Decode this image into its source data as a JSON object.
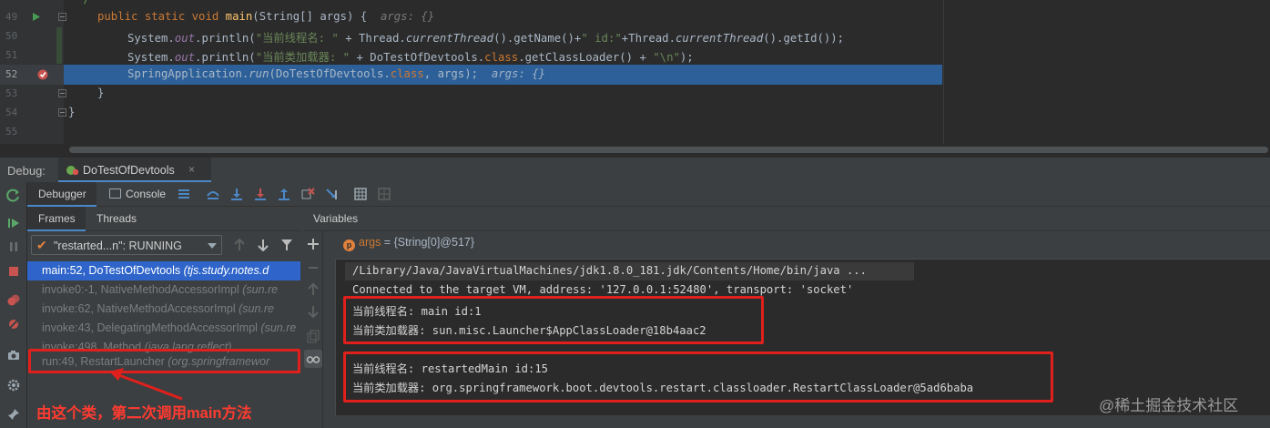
{
  "editor": {
    "line_numbers": [
      "49",
      "50",
      "51",
      "52",
      "53",
      "54",
      "55"
    ],
    "lines": {
      "l48_fragment": "*/",
      "l49": {
        "kw1": "public static void ",
        "method": "main",
        "rest": "(String[] args) {",
        "hint": "args: {}"
      },
      "l50": {
        "a": "System.",
        "out": "out",
        "b": ".println(",
        "s1": "\"当前线程名: \"",
        "c": " + Thread.",
        "ct": "currentThread",
        "d": "().getName()+",
        "s2": "\" id:\"",
        "e": "+Thread.",
        "ct2": "currentThread",
        "f": "().getId());"
      },
      "l51": {
        "a": "System.",
        "out": "out",
        "b": ".println(",
        "s1": "\"当前类加载器: \"",
        "c": " + DoTestOfDevtools.",
        "kw": "class",
        "d": ".getClassLoader() + ",
        "s2": "\"\\n\"",
        "e": ");"
      },
      "l52": {
        "a": "SpringApplication.",
        "run": "run",
        "b": "(DoTestOfDevtools.",
        "kw": "class",
        "c": ", args);",
        "hint": "args: {}"
      },
      "l53": "}",
      "l54": "}"
    }
  },
  "debug": {
    "title": "Debug:",
    "tab_label": "DoTestOfDevtools",
    "tab_close": "×",
    "toolbar": {
      "debugger_label": "Debugger",
      "console_label": "Console"
    },
    "frames_tab": "Frames",
    "threads_tab": "Threads",
    "thread_selector": "\"restarted...n\": RUNNING",
    "frames": [
      {
        "text": "main:52, DoTestOfDevtools ",
        "pkg": "(tjs.study.notes.d"
      },
      {
        "text": "invoke0:-1, NativeMethodAccessorImpl ",
        "pkg": "(sun.re"
      },
      {
        "text": "invoke:62, NativeMethodAccessorImpl ",
        "pkg": "(sun.re"
      },
      {
        "text": "invoke:43, DelegatingMethodAccessorImpl ",
        "pkg": "(sun.re"
      },
      {
        "text": "invoke:498, Method ",
        "pkg": "(java.lang.reflect)"
      },
      {
        "text": "run:49, RestartLauncher ",
        "pkg": "(org.springframewor"
      }
    ],
    "variables_label": "Variables",
    "variable": {
      "badge": "p",
      "name": "args",
      "value": " = {String[0]@517}"
    }
  },
  "console": {
    "lines": [
      "/Library/Java/JavaVirtualMachines/jdk1.8.0_181.jdk/Contents/Home/bin/java ...",
      "Connected to the target VM, address: '127.0.0.1:52480', transport: 'socket'",
      "当前线程名: main id:1",
      "当前类加载器: sun.misc.Launcher$AppClassLoader@18b4aac2",
      "",
      "当前线程名: restartedMain id:15",
      "当前类加载器: org.springframework.boot.devtools.restart.classloader.RestartClassLoader@5ad6baba"
    ]
  },
  "annotation": {
    "text": "由这个类，第二次调用main方法"
  },
  "watermark": "@稀土掘金技术社区",
  "colors": {
    "accent": "#4a88c7",
    "selection": "#2f65ca",
    "annotation_red": "#e0201c"
  }
}
